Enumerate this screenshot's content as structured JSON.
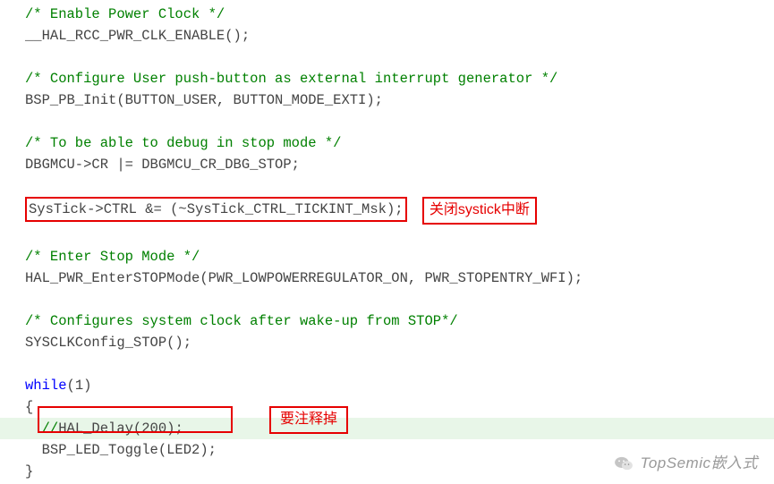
{
  "code": {
    "c1": "/* Enable Power Clock */",
    "l1": "__HAL_RCC_PWR_CLK_ENABLE();",
    "c2": "/* Configure User push-button as external interrupt generator */",
    "l2": "BSP_PB_Init(BUTTON_USER, BUTTON_MODE_EXTI);",
    "c3": "/* To be able to debug in stop mode */",
    "l3": "DBGMCU->CR |= DBGMCU_CR_DBG_STOP;",
    "l4": "SysTick->CTRL &= (~SysTick_CTRL_TICKINT_Msk);",
    "note1": "关闭systick中断",
    "c4": "/* Enter Stop Mode */",
    "l5": "HAL_PWR_EnterSTOPMode(PWR_LOWPOWERREGULATOR_ON, PWR_STOPENTRY_WFI);",
    "c5": "/* Configures system clock after wake-up from STOP*/",
    "l6": "SYSCLKConfig_STOP();",
    "kw_while": "while",
    "one": "1",
    "paren_open": "(",
    "paren_close": ")",
    "brace_open": "{",
    "brace_close": "}",
    "l7a": "//",
    "l7b": "HAL_Delay(200);",
    "note2": "要注释掉",
    "l8": "BSP_LED_Toggle(LED2);"
  },
  "watermark": "TopSemic嵌入式"
}
